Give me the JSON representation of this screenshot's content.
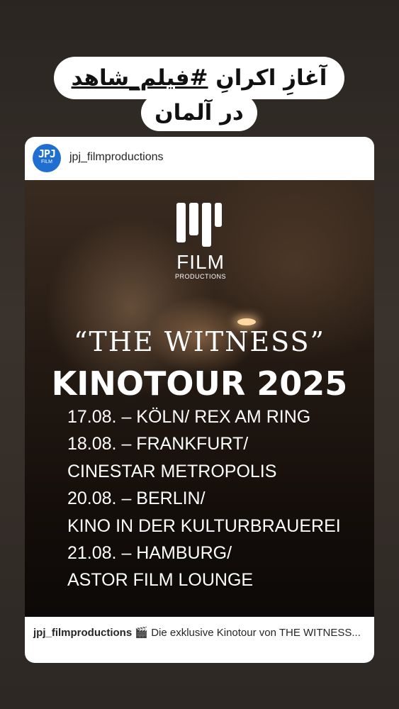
{
  "story_title": {
    "line1_prefix": "آغازِ اکرانِ ",
    "line1_hashtag": "#فیلم_شاهد",
    "line2": "در آلمان"
  },
  "post": {
    "username": "jpj_filmproductions",
    "avatar_text": "JPJ",
    "avatar_sub": "FILM",
    "logo_film": "FILM",
    "logo_productions": "PRODUCTIONS",
    "title": "“THE WITNESS”",
    "subtitle": "KINOTOUR 2025",
    "date_lines": [
      "17.08. – KÖLN/ REX AM RING",
      "18.08. – FRANKFURT/",
      "CINESTAR METROPOLIS",
      "20.08. – BERLIN/",
      "KINO IN DER KULTURBRAUEREI",
      "21.08. – HAMBURG/",
      "ASTOR FILM LOUNGE"
    ],
    "caption_user": "jpj_filmproductions",
    "caption_emoji": "🎬",
    "caption_text": " Die exklusive Kinotour von THE WITNESS..."
  },
  "colors": {
    "avatar_bg": "#1f6fd0",
    "background": "#2a2521",
    "card_bg": "#ffffff"
  },
  "icons": [
    "clapper-board-icon"
  ]
}
